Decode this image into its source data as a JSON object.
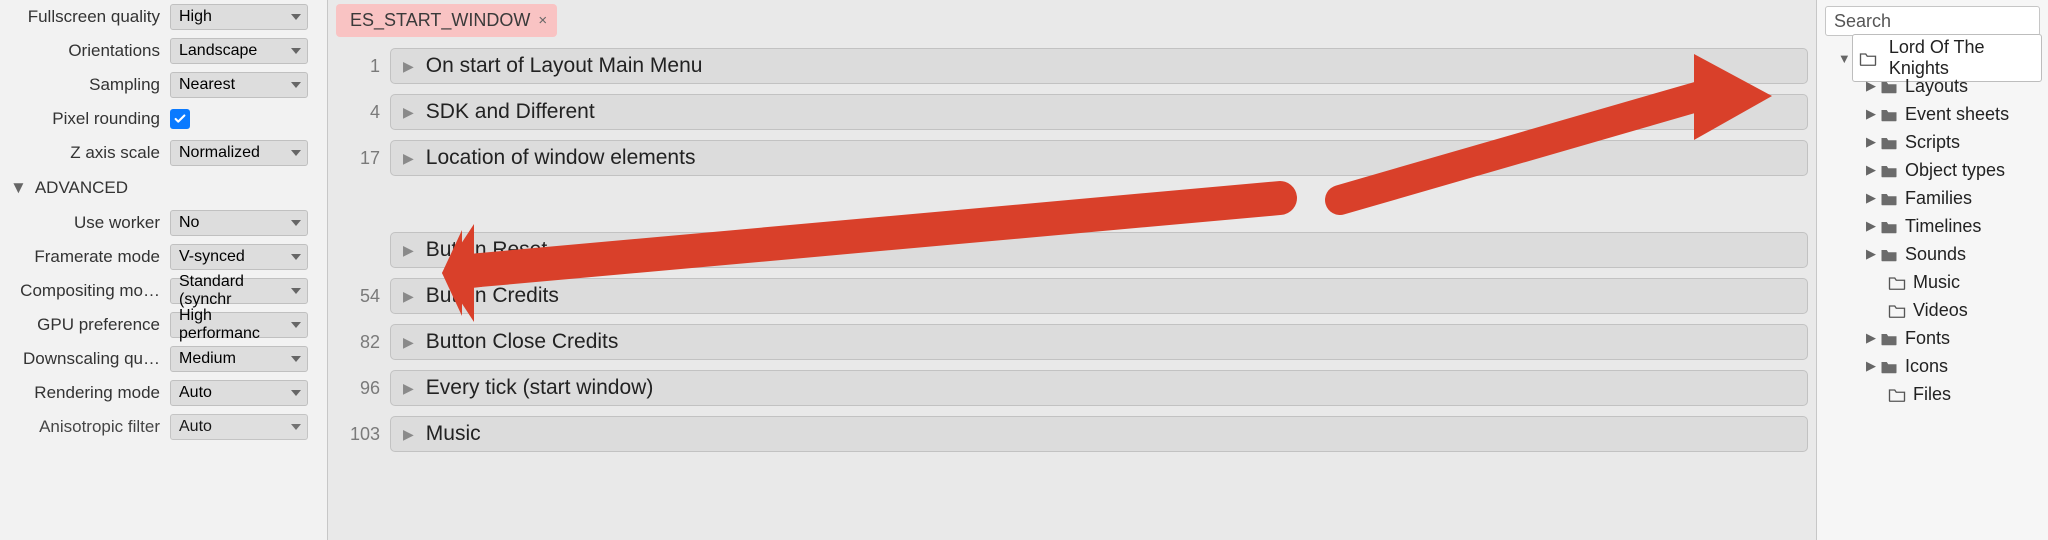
{
  "properties": {
    "fullscreen_quality": {
      "label": "Fullscreen quality",
      "value": "High"
    },
    "orientations": {
      "label": "Orientations",
      "value": "Landscape"
    },
    "sampling": {
      "label": "Sampling",
      "value": "Nearest"
    },
    "pixel_rounding_label": "Pixel rounding",
    "z_axis_scale": {
      "label": "Z axis scale",
      "value": "Normalized"
    },
    "advanced_header": "ADVANCED",
    "use_worker": {
      "label": "Use worker",
      "value": "No"
    },
    "framerate_mode": {
      "label": "Framerate mode",
      "value": "V-synced"
    },
    "compositing_mode": {
      "label": "Compositing mo…",
      "value": "Standard (synchr"
    },
    "gpu_preference": {
      "label": "GPU preference",
      "value": "High performanc"
    },
    "downscaling_quality": {
      "label": "Downscaling qu…",
      "value": "Medium"
    },
    "rendering_mode": {
      "label": "Rendering mode",
      "value": "Auto"
    },
    "anisotropic_filter": {
      "label": "Anisotropic filter",
      "value": "Auto"
    }
  },
  "tab": {
    "label": "ES_START_WINDOW",
    "close": "×"
  },
  "events": [
    {
      "line": "1",
      "title": "On start of Layout Main Menu"
    },
    {
      "line": "4",
      "title": "SDK and Different"
    },
    {
      "line": "17",
      "title": "Location of window elements"
    },
    {
      "line": "",
      "title": ""
    },
    {
      "line": "",
      "title": "Button Reset"
    },
    {
      "line": "54",
      "title": "Button Credits"
    },
    {
      "line": "82",
      "title": "Button Close Credits"
    },
    {
      "line": "96",
      "title": "Every tick (start window)"
    },
    {
      "line": "103",
      "title": "Music"
    }
  ],
  "search_placeholder": "Search",
  "project_name": "Lord Of The Knights",
  "tree": [
    {
      "label": "Layouts",
      "expandable": true,
      "solid": true
    },
    {
      "label": "Event sheets",
      "expandable": true,
      "solid": true
    },
    {
      "label": "Scripts",
      "expandable": true,
      "solid": true
    },
    {
      "label": "Object types",
      "expandable": true,
      "solid": true
    },
    {
      "label": "Families",
      "expandable": true,
      "solid": true
    },
    {
      "label": "Timelines",
      "expandable": true,
      "solid": true
    },
    {
      "label": "Sounds",
      "expandable": true,
      "solid": true
    },
    {
      "label": "Music",
      "expandable": false,
      "solid": false
    },
    {
      "label": "Videos",
      "expandable": false,
      "solid": false
    },
    {
      "label": "Fonts",
      "expandable": true,
      "solid": true
    },
    {
      "label": "Icons",
      "expandable": true,
      "solid": true
    },
    {
      "label": "Files",
      "expandable": false,
      "solid": false
    }
  ]
}
